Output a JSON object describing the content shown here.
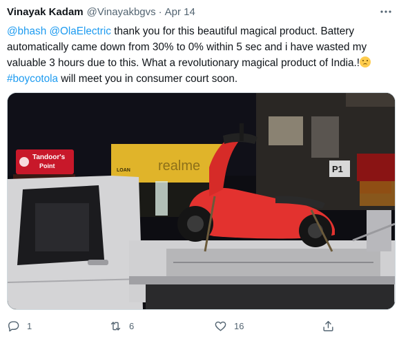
{
  "tweet": {
    "author_name": "Vinayak Kadam",
    "author_handle": "@Vinayakbgvs",
    "separator": "·",
    "date": "Apr 14",
    "text": {
      "mention1": "@bhash",
      "mention2": "@OlaElectric",
      "part1": " thank you for this beautiful magical product.  Battery automatically came down from 30% to 0%  within 5 sec and i have wasted my valuable 3 hours due to this.  What a revolutionary magical product of India.!",
      "hashtag": "#boycotola",
      "part2": " will meet you in consumer court soon."
    },
    "media": {
      "sign_restaurant_line1": "Tandoor's",
      "sign_restaurant_line2": "Point",
      "sign_realme": "realme",
      "sign_parking": "P1",
      "sign_loan": "LOAN"
    },
    "actions": {
      "reply_count": "1",
      "retweet_count": "6",
      "like_count": "16"
    },
    "icons": {
      "more": "more-icon",
      "reply": "reply-icon",
      "retweet": "retweet-icon",
      "like": "like-icon",
      "share": "share-icon",
      "emoji": "crying-face-emoji"
    },
    "colors": {
      "link": "#1d9bf0",
      "secondary_text": "#536471",
      "scooter": "#e3322f"
    }
  }
}
